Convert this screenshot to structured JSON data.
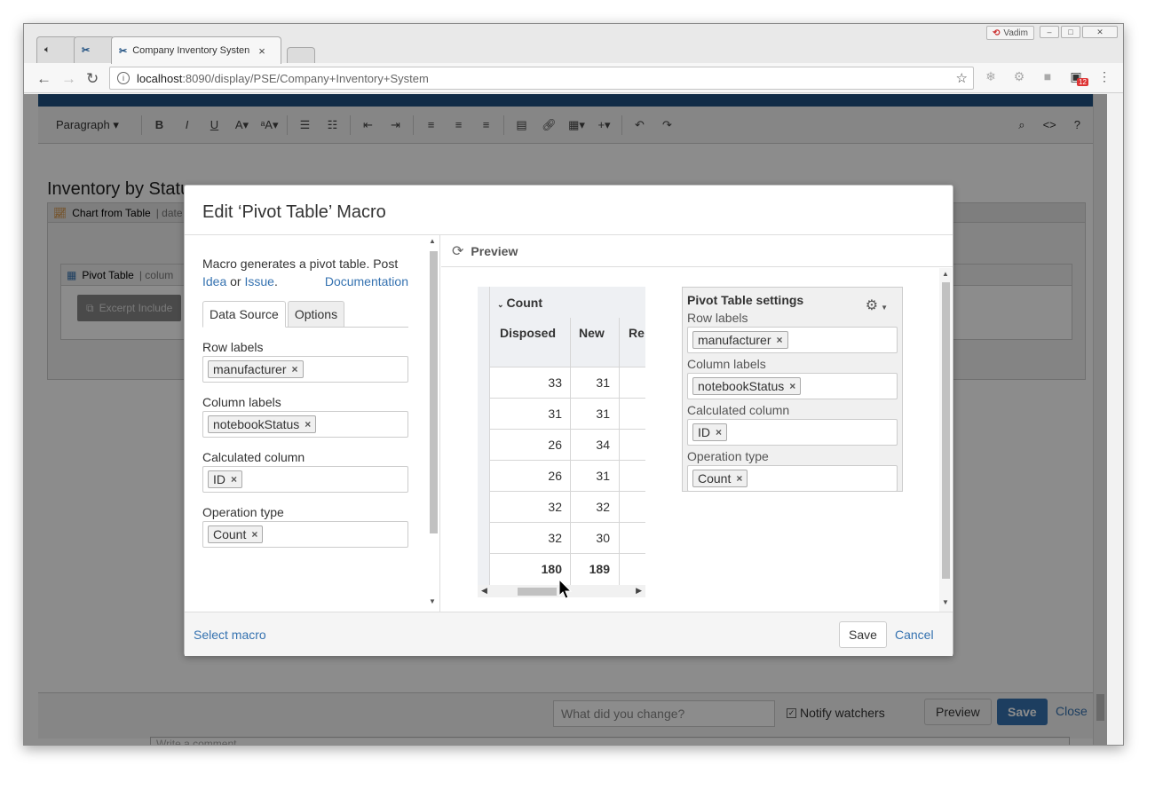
{
  "browser": {
    "tabs": [
      {
        "label": "",
        "icon": "speaker-icon"
      },
      {
        "label": "",
        "icon": "app-icon"
      },
      {
        "label": "Company Inventory Systen"
      }
    ],
    "user": "Vadim",
    "address": {
      "host": "localhost",
      "path": ":8090/display/PSE/Company+Inventory+System"
    },
    "badge": "12"
  },
  "editor": {
    "paragraph_style": "Paragraph",
    "page_title": "Inventory by Status",
    "chart_macro_label": "Chart from Table",
    "chart_macro_suffix": "| date",
    "pivot_macro_label": "Pivot Table",
    "pivot_macro_suffix": "| colum",
    "excerpt_label": "Excerpt Include",
    "changes_placeholder": "What did you change?",
    "notify_label": "Notify watchers",
    "preview_label": "Preview",
    "save_label": "Save",
    "close_label": "Close",
    "comment_placeholder": "Write a comment..."
  },
  "dialog": {
    "title": "Edit ‘Pivot Table’ Macro",
    "description": "Macro generates a pivot table. Post",
    "link_idea": "Idea",
    "or_text": "or",
    "link_issue": "Issue",
    "period": ".",
    "link_documentation": "Documentation",
    "tabs": [
      "Data Source",
      "Options"
    ],
    "fields": [
      {
        "label": "Row labels",
        "value": "manufacturer"
      },
      {
        "label": "Column labels",
        "value": "notebookStatus"
      },
      {
        "label": "Calculated column",
        "value": "ID"
      },
      {
        "label": "Operation type",
        "value": "Count"
      }
    ],
    "preview_title": "Preview",
    "select_macro": "Select macro",
    "save": "Save",
    "cancel": "Cancel"
  },
  "pivot": {
    "header": "Count",
    "columns": [
      "Disposed",
      "New",
      "Re"
    ],
    "rows": [
      [
        "33",
        "31"
      ],
      [
        "31",
        "31"
      ],
      [
        "26",
        "34"
      ],
      [
        "26",
        "31"
      ],
      [
        "32",
        "32"
      ],
      [
        "32",
        "30"
      ]
    ],
    "totals": [
      "180",
      "189"
    ]
  },
  "settings": {
    "title": "Pivot Table settings",
    "fields": [
      {
        "label": "Row labels",
        "value": "manufacturer"
      },
      {
        "label": "Column labels",
        "value": "notebookStatus"
      },
      {
        "label": "Calculated column",
        "value": "ID"
      },
      {
        "label": "Operation type",
        "value": "Count"
      }
    ]
  }
}
